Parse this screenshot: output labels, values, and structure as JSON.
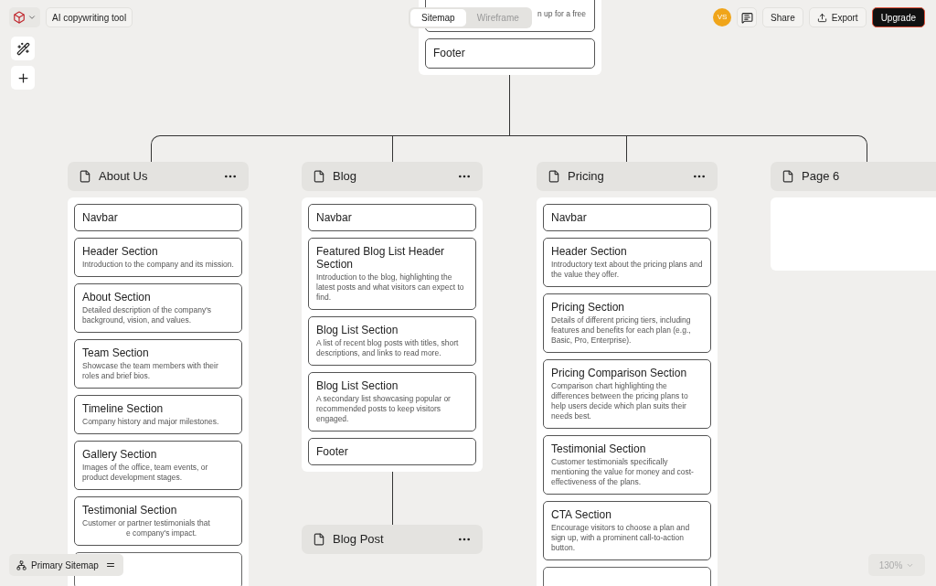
{
  "toolbar": {
    "project": "AI copywriting tool",
    "view_tabs": [
      {
        "label": "Sitemap",
        "selected": true
      },
      {
        "label": "Wireframe",
        "selected": false
      }
    ],
    "avatar": "VS",
    "buttons": [
      "Share",
      "Export"
    ],
    "upgrade": "Upgrade"
  },
  "top_page": {
    "sections": [
      {
        "desc": "n up for a free"
      },
      {
        "title": "Footer"
      }
    ]
  },
  "pages": [
    {
      "title": "About Us",
      "sections": [
        {
          "title": "Navbar"
        },
        {
          "title": "Header Section",
          "desc": "Introduction to the company and its mission."
        },
        {
          "title": "About Section",
          "desc": "Detailed description of the company's background, vision, and values."
        },
        {
          "title": "Team Section",
          "desc": "Showcase the team members with their roles and brief bios."
        },
        {
          "title": "Timeline Section",
          "desc": "Company history and major milestones."
        },
        {
          "title": "Gallery Section",
          "desc": "Images of the office, team events, or product development stages."
        },
        {
          "title": "Testimonial Section",
          "desc": "Customer or partner testimonials that",
          "desc_tail": "e company's impact."
        },
        {
          "kind": "cut"
        }
      ]
    },
    {
      "title": "Blog",
      "sections": [
        {
          "title": "Navbar"
        },
        {
          "title": "Featured Blog List Header Section",
          "desc": "Introduction to the blog, highlighting the latest posts and what visitors can expect to find."
        },
        {
          "title": "Blog List Section",
          "desc": "A list of recent blog posts with titles, short descriptions, and links to read more."
        },
        {
          "title": "Blog List Section",
          "desc": "A secondary list showcasing popular or recommended posts to keep visitors engaged."
        },
        {
          "title": "Footer"
        }
      ],
      "children": [
        {
          "title": "Blog Post"
        }
      ]
    },
    {
      "title": "Pricing",
      "sections": [
        {
          "title": "Navbar"
        },
        {
          "title": "Header Section",
          "desc": "Introductory text about the pricing plans and the value they offer."
        },
        {
          "title": "Pricing Section",
          "desc": "Details of different pricing tiers, including features and benefits for each plan (e.g., Basic, Pro, Enterprise)."
        },
        {
          "title": "Pricing Comparison Section",
          "desc": "Comparison chart highlighting the differences between the pricing plans to help users decide which plan suits their needs best."
        },
        {
          "title": "Testimonial Section",
          "desc": "Customer testimonials specifically mentioning the value for money and cost-effectiveness of the plans."
        },
        {
          "title": "CTA Section",
          "desc": "Encourage visitors to choose a plan and sign up, with a prominent call-to-action button."
        },
        {
          "kind": "cut"
        }
      ]
    },
    {
      "title": "Page 6"
    }
  ],
  "sitemap_button": "Primary Sitemap",
  "zoom": "130%"
}
